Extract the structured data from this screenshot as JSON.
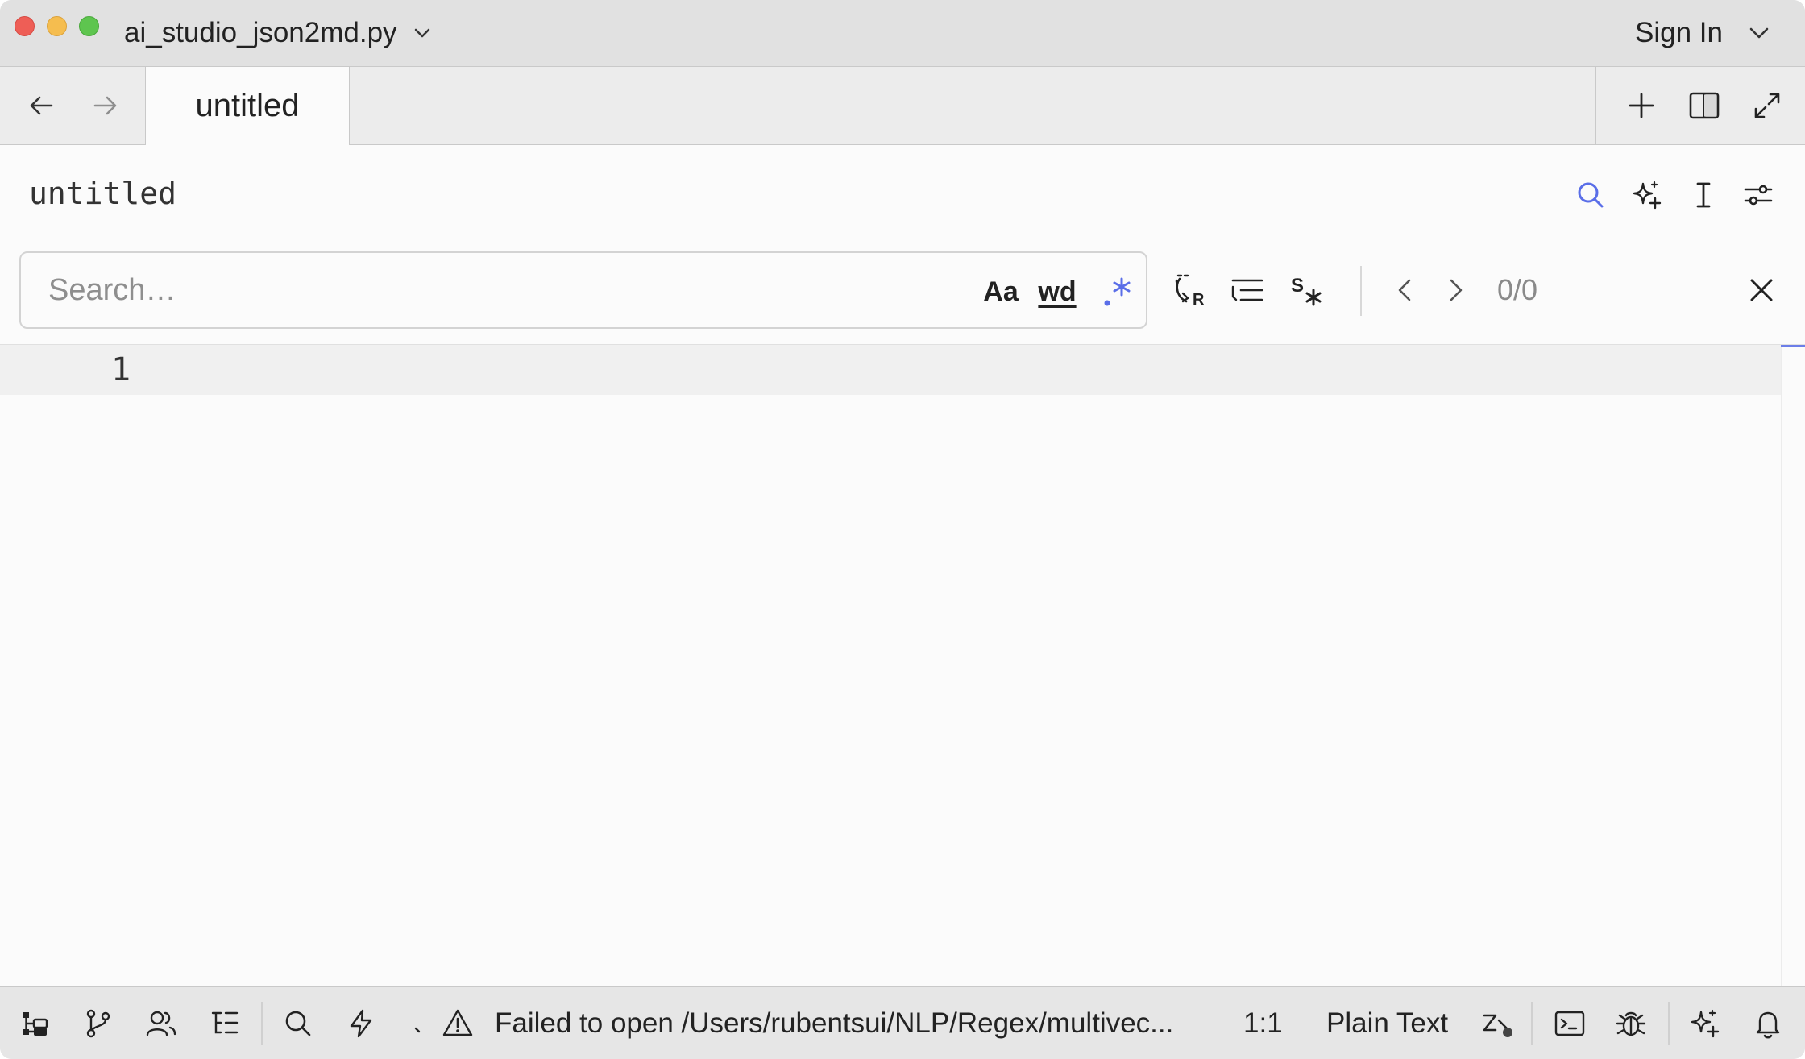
{
  "window": {
    "project_title": "ai_studio_json2md.py",
    "sign_in_label": "Sign In"
  },
  "tabs": [
    {
      "label": "untitled",
      "active": true
    }
  ],
  "editor": {
    "file_title": "untitled",
    "search": {
      "placeholder": "Search…",
      "value": "",
      "case_label": "Aa",
      "word_label": "wd",
      "match_count": "0/0"
    },
    "lines": [
      {
        "number": "1",
        "text": ""
      }
    ]
  },
  "status_bar": {
    "message": "Failed to open /Users/rubentsui/NLP/Regex/multivec...",
    "cursor_position": "1:1",
    "language": "Plain Text"
  },
  "colors": {
    "accent": "#5a6ee8",
    "titlebar": "#e1e1e1",
    "tabbar": "#ececec",
    "statusbar": "#e6e6e6",
    "editor_bg": "#fbfbfb",
    "current_line": "#f0f0f0"
  },
  "icons": {
    "titlebar": [
      "chevron-down-icon"
    ],
    "tabbar": [
      "arrow-left-icon",
      "arrow-right-icon",
      "plus-icon",
      "split-pane-icon",
      "maximize-icon"
    ],
    "editor_header": [
      "search-icon",
      "sparkle-icon",
      "text-cursor-icon",
      "sliders-icon"
    ],
    "find_bar": [
      "regex-icon",
      "select-occurrence-icon",
      "multiline-icon",
      "regex-star-icon",
      "chevron-left-icon",
      "chevron-right-icon",
      "close-icon"
    ],
    "status_bar": [
      "project-panel-icon",
      "git-branch-icon",
      "collaborators-icon",
      "outline-icon",
      "search-icon",
      "lightning-icon",
      "dot-icon",
      "warning-icon",
      "vim-mode-icon",
      "terminal-icon",
      "debug-icon",
      "assistant-sparkle-icon",
      "bell-icon"
    ]
  }
}
